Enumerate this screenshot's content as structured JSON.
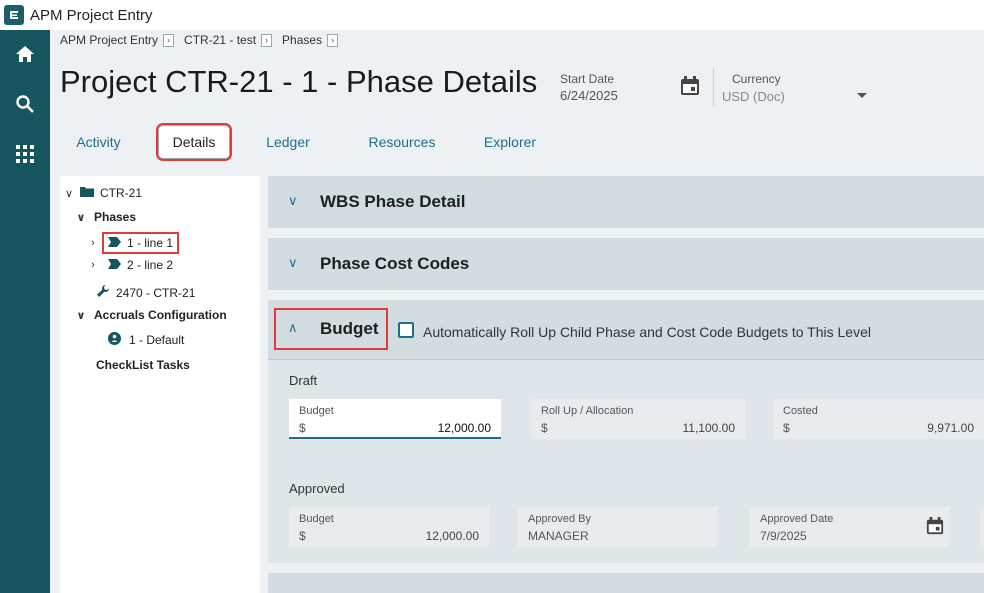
{
  "app": {
    "title": "APM Project Entry"
  },
  "breadcrumb": [
    "APM Project Entry",
    "CTR-21 - test",
    "Phases"
  ],
  "page": {
    "title": "Project CTR-21 - 1 - Phase Details"
  },
  "header_fields": {
    "start_date_label": "Start Date",
    "start_date_value": "6/24/2025",
    "currency_label": "Currency",
    "currency_value": "USD (Doc)"
  },
  "tabs": [
    {
      "label": "Activity"
    },
    {
      "label": "Details"
    },
    {
      "label": "Ledger"
    },
    {
      "label": "Resources"
    },
    {
      "label": "Explorer"
    }
  ],
  "tree": {
    "root": "CTR-21",
    "phases_label": "Phases",
    "phase1": "1 - line 1",
    "phase2": "2 - line 2",
    "resource": "2470 - CTR-21",
    "accruals_label": "Accruals Configuration",
    "accrual_default": "1 - Default",
    "checklist": "CheckList Tasks"
  },
  "sections": {
    "wbs": "WBS Phase Detail",
    "cost_codes": "Phase Cost Codes",
    "budget": "Budget",
    "rollup_checkbox_label": "Automatically Roll Up Child Phase and Cost Code Budgets to This Level"
  },
  "draft": {
    "label": "Draft",
    "budget_label": "Budget",
    "budget_currency": "$",
    "budget_value": "12,000.00",
    "rollup_label": "Roll Up / Allocation",
    "rollup_currency": "$",
    "rollup_value": "11,100.00",
    "costed_label": "Costed",
    "costed_currency": "$",
    "costed_value": "9,971.00"
  },
  "approved": {
    "label": "Approved",
    "budget_label": "Budget",
    "budget_currency": "$",
    "budget_value": "12,000.00",
    "approved_by_label": "Approved By",
    "approved_by_value": "MANAGER",
    "approved_date_label": "Approved Date",
    "approved_date_value": "7/9/2025"
  },
  "colors": {
    "rail": "#17565f",
    "accent": "#1f6e8c",
    "highlight": "#e23b3b"
  }
}
